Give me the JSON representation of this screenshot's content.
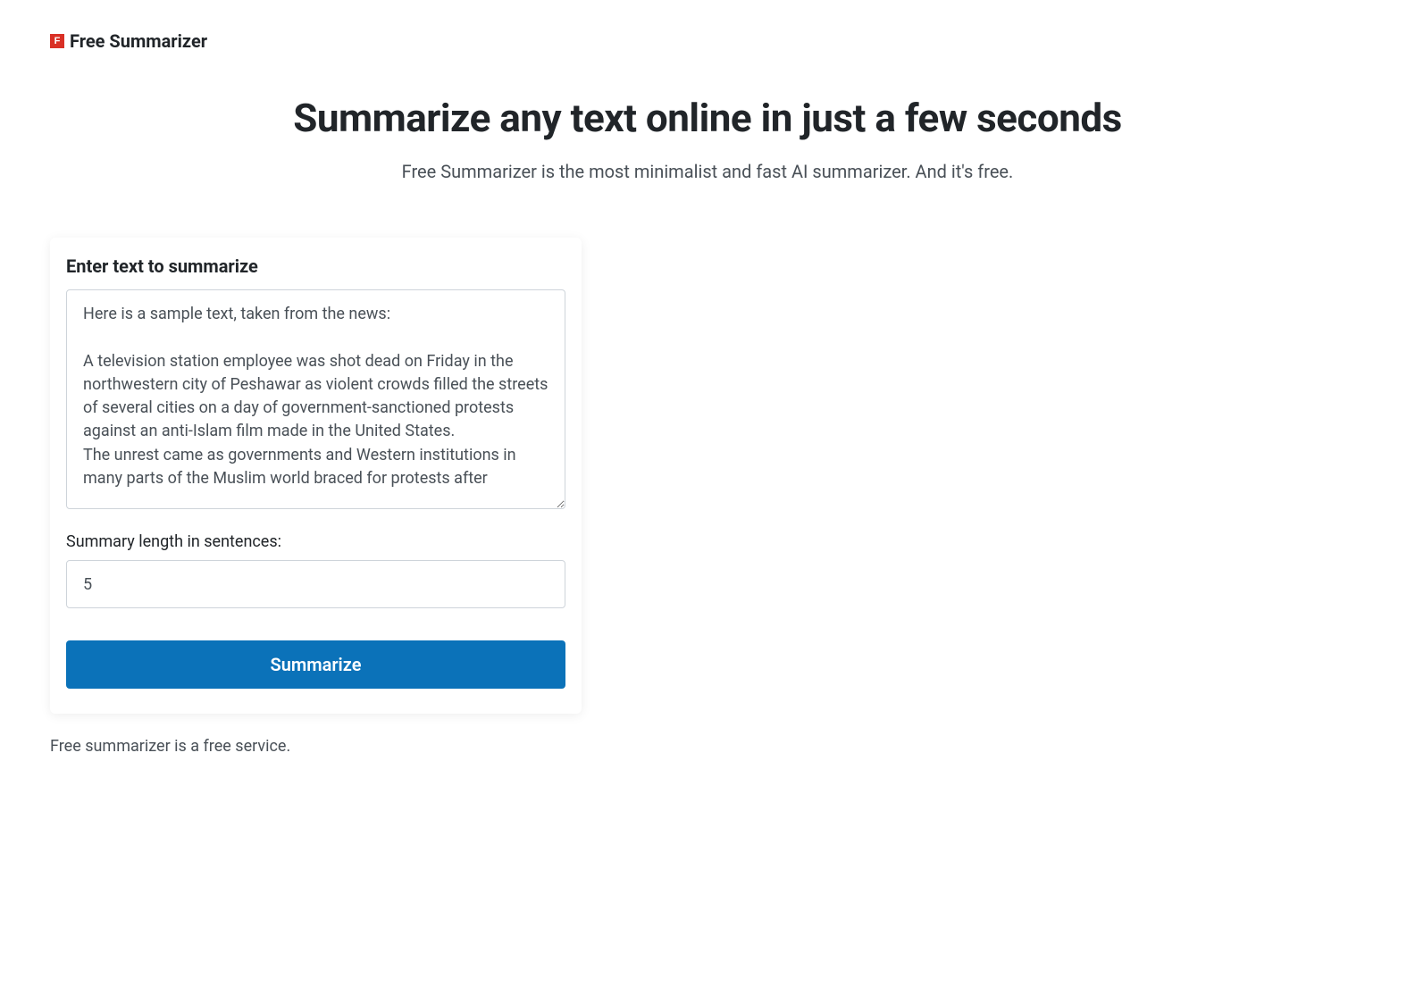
{
  "brand": {
    "name": "Free Summarizer",
    "logo_letter": "F"
  },
  "hero": {
    "title": "Summarize any text online in just a few seconds",
    "subtitle": "Free Summarizer is the most minimalist and fast AI summarizer. And it's free."
  },
  "card": {
    "title": "Enter text to summarize",
    "textarea_value": "Here is a sample text, taken from the news:\n\nA television station employee was shot dead on Friday in the northwestern city of Peshawar as violent crowds filled the streets of several cities on a day of government-sanctioned protests against an anti-Islam film made in the United States.\nThe unrest came as governments and Western institutions in many parts of the Muslim world braced for protests after",
    "length_label": "Summary length in sentences:",
    "length_value": "5",
    "button_label": "Summarize"
  },
  "footer": {
    "note": "Free summarizer is a free service."
  }
}
